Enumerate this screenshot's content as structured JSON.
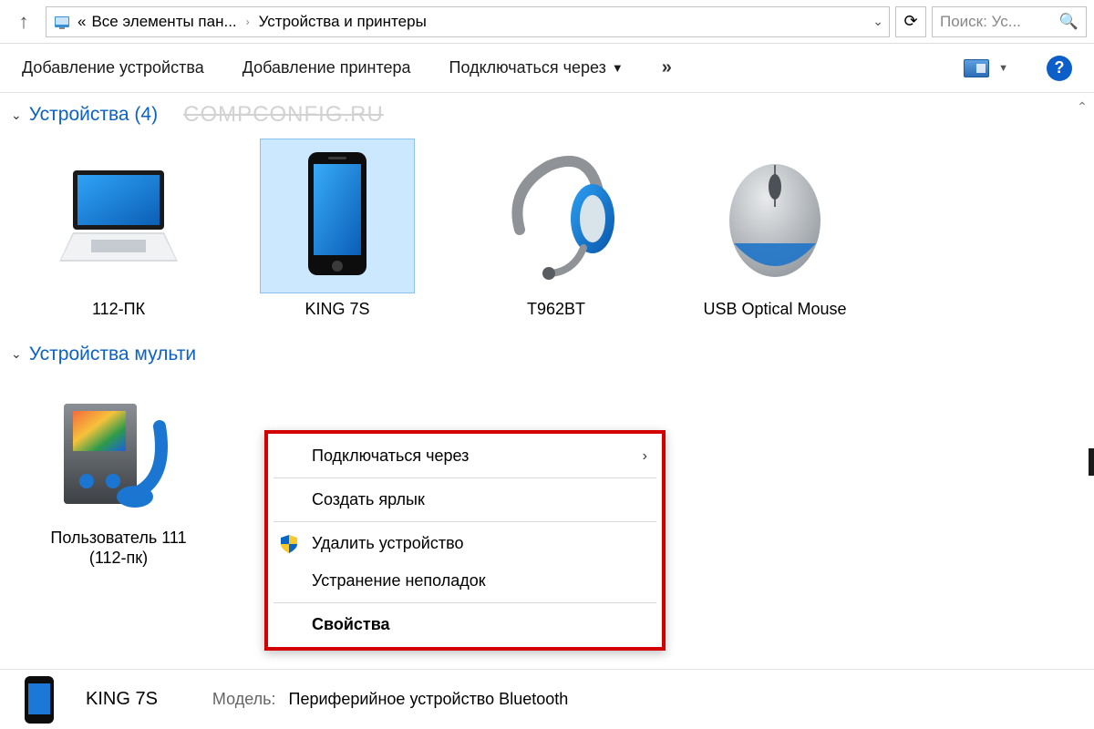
{
  "addressbar": {
    "prefix": "«",
    "crumb1": "Все элементы пан...",
    "crumb2": "Устройства и принтеры"
  },
  "search": {
    "placeholder": "Поиск: Ус..."
  },
  "toolbar": {
    "add_device": "Добавление устройства",
    "add_printer": "Добавление принтера",
    "connect_via": "Подключаться через",
    "overflow": "»",
    "help": "?"
  },
  "sections": {
    "devices": {
      "title": "Устройства (4)"
    },
    "multimedia": {
      "title": "Устройства мульти"
    }
  },
  "watermark": "COMPCONFIG.RU",
  "devices": [
    {
      "label": "112-ПК"
    },
    {
      "label": "KING 7S"
    },
    {
      "label": "T962BT"
    },
    {
      "label": "USB Optical Mouse"
    }
  ],
  "mm_devices": [
    {
      "label": "Пользователь 111 (112-пк)"
    }
  ],
  "context_menu": {
    "connect_via": "Подключаться через",
    "create_shortcut": "Создать ярлык",
    "delete_device": "Удалить устройство",
    "troubleshoot": "Устранение неполадок",
    "properties": "Свойства"
  },
  "details": {
    "name": "KING 7S",
    "model_label": "Модель:",
    "model_value": "Периферийное устройство Bluetooth"
  }
}
